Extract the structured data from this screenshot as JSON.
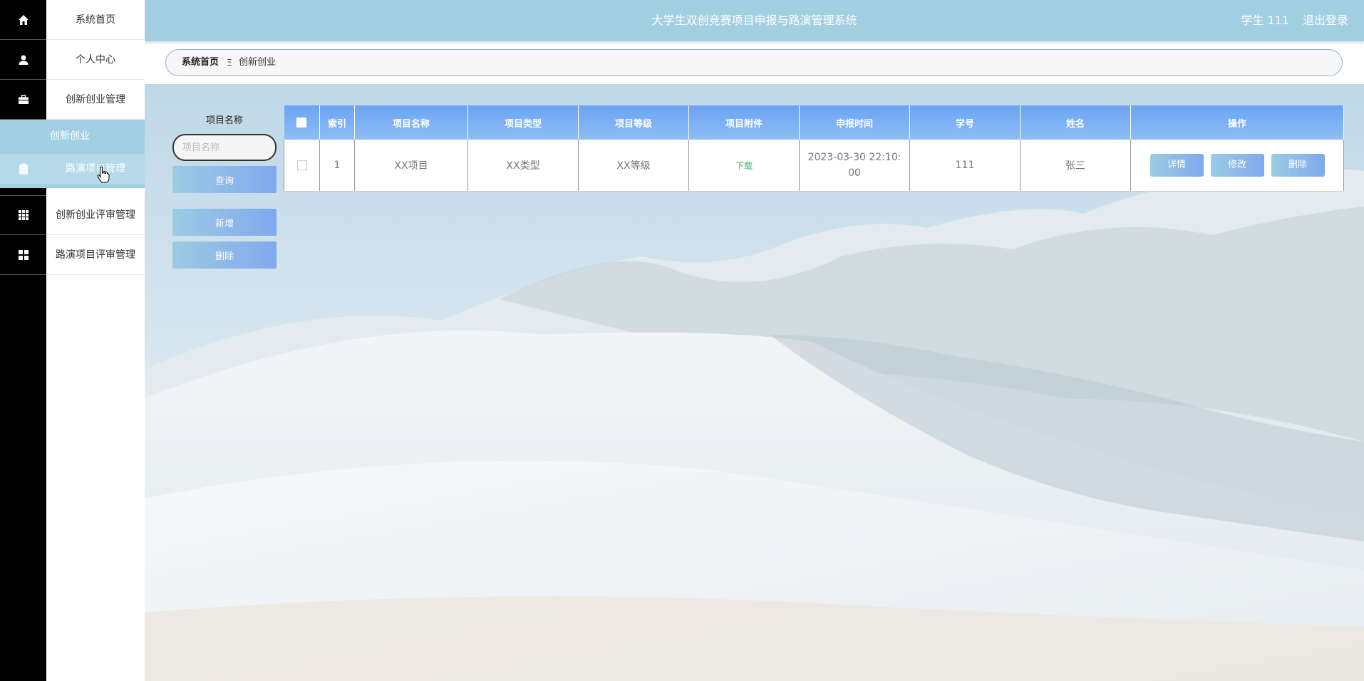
{
  "header": {
    "title": "大学生双创竞赛项目申报与路演管理系统",
    "user_text": "学生 111",
    "logout_label": "退出登录"
  },
  "sidebar": {
    "items": [
      {
        "label": "系统首页",
        "icon": "home-icon"
      },
      {
        "label": "个人中心",
        "icon": "user-icon"
      },
      {
        "label": "创新创业管理",
        "icon": "briefcase-icon"
      },
      {
        "label": "创新创业评审管理",
        "icon": "grid-icon"
      },
      {
        "label": "路演项目评审管理",
        "icon": "dashboard-icon"
      }
    ],
    "submenu": [
      {
        "label": "创新创业"
      },
      {
        "label": "路演项目管理",
        "icon": "clipboard-icon"
      }
    ]
  },
  "breadcrumb": {
    "home": "系统首页",
    "separator": "Ξ",
    "current": "创新创业"
  },
  "search": {
    "label": "项目名称",
    "placeholder": "项目名称",
    "query_button": "查询",
    "add_button": "新增",
    "delete_button": "删除"
  },
  "table": {
    "columns": [
      "索引",
      "项目名称",
      "项目类型",
      "项目等级",
      "项目附件",
      "申报时间",
      "学号",
      "姓名",
      "操作"
    ],
    "rows": [
      {
        "index": "1",
        "name": "XX项目",
        "type": "XX类型",
        "level": "XX等级",
        "attachment": "下载",
        "time": "2023-03-30 22:10:00",
        "student_id": "111",
        "student_name": "张三",
        "actions": [
          "详情",
          "修改",
          "删除"
        ]
      }
    ]
  },
  "colors": {
    "header": "#a3cfe2",
    "sidebar_icon_strip": "#000000",
    "button_gradient_start": "#9ccbe3",
    "button_gradient_end": "#7fa9ee",
    "table_header": "#6aa4f4",
    "download_link": "#3cb371"
  }
}
